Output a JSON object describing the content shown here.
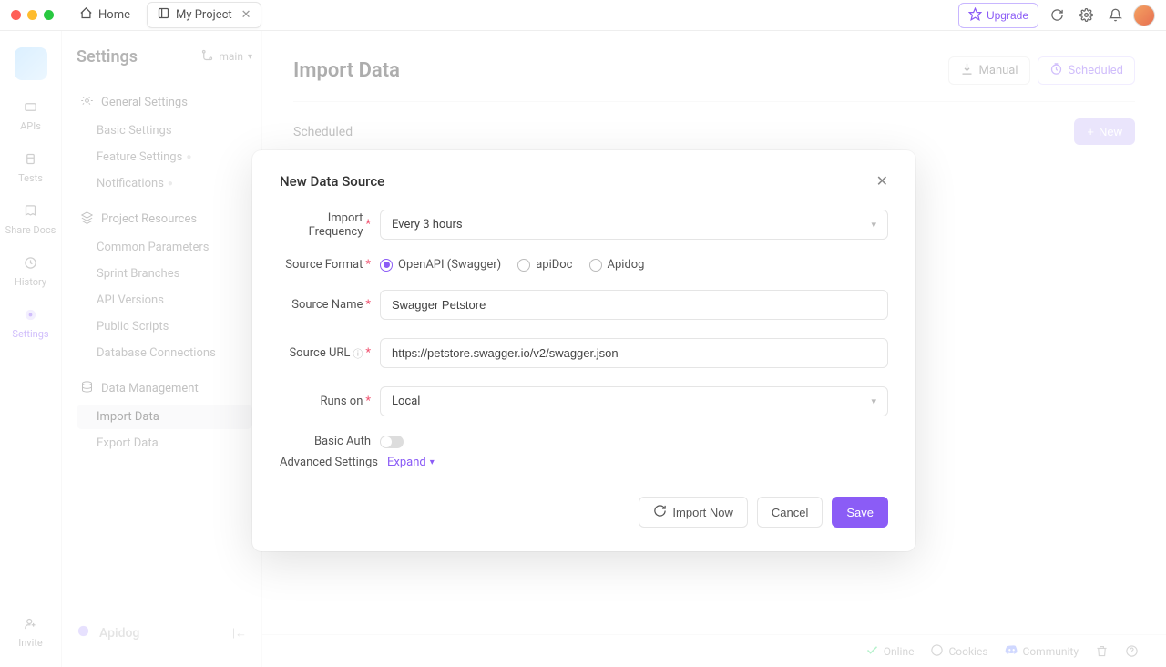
{
  "titlebar": {
    "home": "Home",
    "project_tab": "My Project",
    "upgrade": "Upgrade"
  },
  "rail": {
    "items": [
      {
        "label": "APIs"
      },
      {
        "label": "Tests"
      },
      {
        "label": "Share Docs"
      },
      {
        "label": "History"
      },
      {
        "label": "Settings"
      }
    ],
    "invite": "Invite"
  },
  "sidebar": {
    "title": "Settings",
    "branch": "main",
    "groups": [
      {
        "head": "General Settings",
        "items": [
          "Basic Settings",
          "Feature Settings",
          "Notifications"
        ]
      },
      {
        "head": "Project Resources",
        "items": [
          "Common Parameters",
          "Sprint Branches",
          "API Versions",
          "Public Scripts",
          "Database Connections"
        ]
      },
      {
        "head": "Data Management",
        "items": [
          "Import Data",
          "Export Data"
        ]
      }
    ],
    "brand": "Apidog"
  },
  "page": {
    "title": "Import Data",
    "tab_manual": "Manual",
    "tab_scheduled": "Scheduled",
    "section": "Scheduled",
    "new_btn": "New"
  },
  "status": {
    "online": "Online",
    "cookies": "Cookies",
    "community": "Community"
  },
  "modal": {
    "title": "New Data Source",
    "labels": {
      "import_frequency": "Import Frequency",
      "source_format": "Source Format",
      "source_name": "Source Name",
      "source_url": "Source URL",
      "runs_on": "Runs on",
      "basic_auth": "Basic Auth",
      "advanced": "Advanced Settings",
      "expand": "Expand"
    },
    "values": {
      "frequency": "Every 3 hours",
      "format_options": [
        "OpenAPI (Swagger)",
        "apiDoc",
        "Apidog"
      ],
      "format_selected": 0,
      "source_name": "Swagger Petstore",
      "source_url": "https://petstore.swagger.io/v2/swagger.json",
      "runs_on": "Local"
    },
    "buttons": {
      "import_now": "Import Now",
      "cancel": "Cancel",
      "save": "Save"
    }
  }
}
